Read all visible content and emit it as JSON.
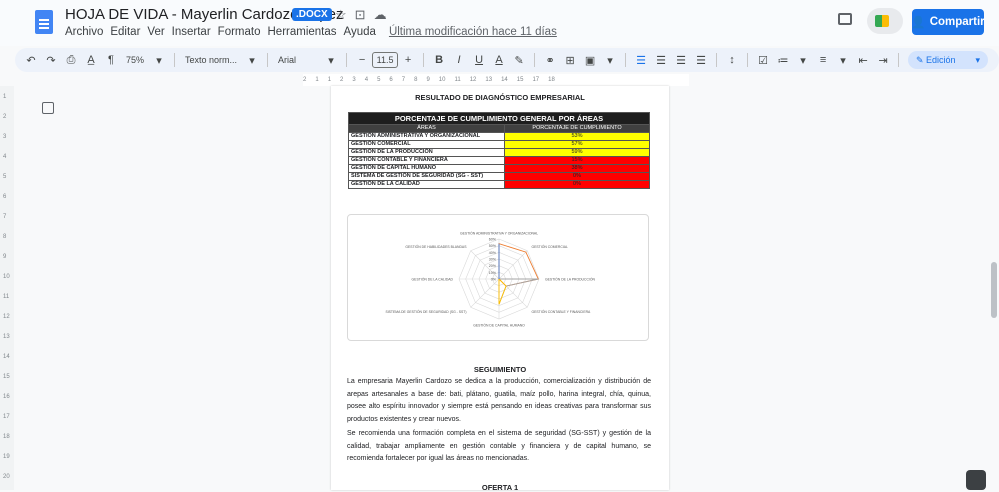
{
  "doc": {
    "title": "HOJA DE VIDA - Mayerlin Cardozo Yepez",
    "badge": ".DOCX",
    "menu": [
      "Archivo",
      "Editar",
      "Ver",
      "Insertar",
      "Formato",
      "Herramientas",
      "Ayuda"
    ],
    "last_modified": "Última modificación hace 11 días",
    "share_label": "Compartir"
  },
  "toolbar": {
    "zoom": "75%",
    "style": "Texto norm...",
    "font": "Arial",
    "font_size": "11.5",
    "bold": "B",
    "italic": "I",
    "underline": "U",
    "text_color": "A",
    "mode": "Edición"
  },
  "ruler": {
    "horizontal": [
      "2",
      "1",
      "1",
      "2",
      "3",
      "4",
      "5",
      "6",
      "7",
      "8",
      "9",
      "10",
      "11",
      "12",
      "13",
      "14",
      "15",
      "17",
      "18"
    ],
    "vertical": [
      "1",
      "2",
      "3",
      "4",
      "5",
      "6",
      "7",
      "8",
      "9",
      "10",
      "11",
      "12",
      "13",
      "14",
      "15",
      "16",
      "17",
      "18",
      "19",
      "20"
    ]
  },
  "page": {
    "heading": "RESULTADO DE DIAGNÓSTICO EMPRESARIAL",
    "table": {
      "title": "PORCENTAJE DE CUMPLIMIENTO GENERAL POR ÁREAS",
      "col_area": "ÁREAS",
      "col_pct": "PORCENTAJE DE CUMPLIMIENTO",
      "rows": [
        {
          "area": "GESTIÓN ADMINISTRATIVA Y ORGANIZACIONAL",
          "pct": "53%",
          "color": "#ffff00"
        },
        {
          "area": "GESTIÓN COMERCIAL",
          "pct": "57%",
          "color": "#ffff00"
        },
        {
          "area": "GESTIÓN DE LA PRODUCCIÓN",
          "pct": "59%",
          "color": "#ffff00"
        },
        {
          "area": "GESTIÓN CONTABLE Y FINANCIERA",
          "pct": "15%",
          "color": "#ff0000"
        },
        {
          "area": "GESTIÓN DE CAPITAL HUMANO",
          "pct": "38%",
          "color": "#ff0000"
        },
        {
          "area": "SISTEMA DE GESTIÓN DE SEGURIDAD (SG - SST)",
          "pct": "0%",
          "color": "#ff0000"
        },
        {
          "area": "GESTIÓN DE LA CALIDAD",
          "pct": "0%",
          "color": "#ff0000"
        }
      ]
    },
    "seguimiento_title": "SEGUIMIENTO",
    "paragraph1": "La empresaria Mayerlin Cardozo se dedica a la producción, comercialización y distribución de arepas artesanales a base de: bati, plátano, guatila, maíz pollo, harina integral, chía, quinua, posee alto espíritu innovador y siempre está pensando en ideas creativas para transformar sus productos existentes y crear nuevos.",
    "paragraph2": "Se recomienda una formación completa en el sistema de seguridad (SG-SST) y gestión de la calidad, trabajar ampliamente en gestión contable y financiera y de capital humano, se recomienda fortalecer por igual las áreas no mencionadas.",
    "next_title": "OFERTA 1"
  },
  "chart_data": {
    "type": "radar",
    "categories": [
      "GESTIÓN ADMINISTRATIVA Y ORGANIZACIONAL",
      "GESTIÓN COMERCIAL",
      "GESTIÓN DE LA PRODUCCIÓN",
      "GESTIÓN CONTABLE Y FINANCIERA",
      "GESTIÓN DE CAPITAL HUMANO",
      "SISTEMA DE GESTIÓN DE SEGURIDAD (SG - SST)",
      "GESTIÓN DE LA CALIDAD",
      "GESTIÓN DE HABILIDADES BLANDAS"
    ],
    "ticks": [
      "0%",
      "10%",
      "20%",
      "30%",
      "40%",
      "50%",
      "60%"
    ],
    "rmax": 60,
    "series": [
      {
        "values": [
          53,
          57,
          59,
          15,
          0,
          0,
          0,
          0
        ],
        "color": "#ed7d31"
      },
      {
        "values": [
          0,
          0,
          59,
          15,
          38,
          0,
          0,
          0
        ],
        "color": "#a5a5a5"
      },
      {
        "values": [
          0,
          0,
          0,
          15,
          38,
          0,
          0,
          0
        ],
        "color": "#ffc000"
      },
      {
        "values": [
          53,
          0,
          0,
          0,
          0,
          0,
          0,
          0
        ],
        "color": "#4472c4"
      }
    ]
  }
}
